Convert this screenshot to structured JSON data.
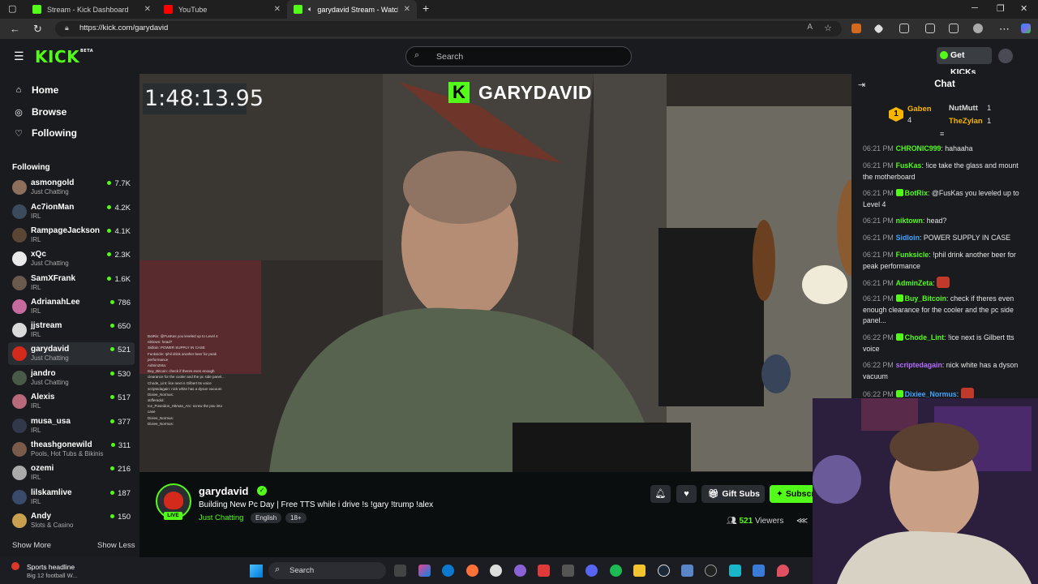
{
  "browser": {
    "tabs": [
      {
        "title": "Stream - Kick Dashboard",
        "color": "#53fc18"
      },
      {
        "title": "YouTube",
        "color": "#ff0000"
      },
      {
        "title": "garydavid Stream - Watch Li",
        "color": "#53fc18"
      }
    ],
    "new_tab_label": "+",
    "url": "https://kick.com/garydavid"
  },
  "header": {
    "logo": "KICK",
    "logo_badge": "BETA",
    "search_placeholder": "Search",
    "get_kicks_label": "Get KICKs"
  },
  "sidebar": {
    "nav": [
      {
        "label": "Home",
        "icon": "home-icon"
      },
      {
        "label": "Browse",
        "icon": "compass-icon"
      },
      {
        "label": "Following",
        "icon": "heart-icon"
      }
    ],
    "following_heading": "Following",
    "following": [
      {
        "name": "asmongold",
        "category": "Just Chatting",
        "viewers": "7.7K",
        "color": "#8e6f5b"
      },
      {
        "name": "Ac7ionMan",
        "category": "IRL",
        "viewers": "4.2K",
        "color": "#3b4a5c"
      },
      {
        "name": "RampageJackson",
        "category": "IRL",
        "viewers": "4.1K",
        "color": "#5b4636"
      },
      {
        "name": "xQc",
        "category": "Just Chatting",
        "viewers": "2.3K",
        "color": "#e9e9e9"
      },
      {
        "name": "SamXFrank",
        "category": "IRL",
        "viewers": "1.6K",
        "color": "#6a5a4e"
      },
      {
        "name": "AdrianahLee",
        "category": "IRL",
        "viewers": "786",
        "color": "#c76a9e"
      },
      {
        "name": "jjstream",
        "category": "IRL",
        "viewers": "650",
        "color": "#d9d9d9"
      },
      {
        "name": "garydavid",
        "category": "Just Chatting",
        "viewers": "521",
        "color": "#d42a1b"
      },
      {
        "name": "jandro",
        "category": "Just Chatting",
        "viewers": "530",
        "color": "#4a5a48"
      },
      {
        "name": "Alexis",
        "category": "IRL",
        "viewers": "517",
        "color": "#b86a7a"
      },
      {
        "name": "musa_usa",
        "category": "IRL",
        "viewers": "377",
        "color": "#30384a"
      },
      {
        "name": "theashgonewild",
        "category": "Pools, Hot Tubs & Bikinis",
        "viewers": "311",
        "color": "#7a5a48"
      },
      {
        "name": "ozemi",
        "category": "IRL",
        "viewers": "216",
        "color": "#aaaaaa"
      },
      {
        "name": "lilskamlive",
        "category": "IRL",
        "viewers": "187",
        "color": "#3a4a6a"
      },
      {
        "name": "Andy",
        "category": "Slots & Casino",
        "viewers": "150",
        "color": "#c8a050"
      }
    ],
    "show_more": "Show More",
    "show_less": "Show Less"
  },
  "video": {
    "timer": "1:48:13.95",
    "brand_letter": "K",
    "brand_name": "GARYDAVID",
    "overlay_chat": [
      "BotRix: @FusKas you leveled up to Level 4",
      "niktown: head?",
      "Sidloin: POWER SUPPLY IN CASE",
      "Funksicle: !phil drink another beer for peak",
      "performance",
      "AdminZeta:",
      "Buy_Bitcoin: check if theres even enough",
      "clearance for the cooler and the pc side panel...",
      "Chode_Lint: lice next is Gilbert tts voice",
      "scriptedagain: nick white has a dyson vacuum",
      "Dixiee_Normus:",
      "stifferadol:",
      "Ice_Poseidon_Hitman_Arc: screw the psu into",
      "case",
      "Dixiee_Normus:",
      "Dixiee_Normus:"
    ]
  },
  "stream": {
    "channel": "garydavid",
    "live_label": "LIVE",
    "title": "Building New Pc Day | Free TTS while i drive !s !gary !trump !alex",
    "category": "Just Chatting",
    "tags": [
      "English",
      "18+"
    ],
    "gift_subs_label": "Gift Subs",
    "subscribe_label": "Subscribe",
    "viewer_count": "521",
    "viewers_label": "Viewers"
  },
  "chat": {
    "title": "Chat",
    "top_gifters": [
      {
        "name": "Gaben",
        "count": "4"
      },
      {
        "name": "NutMutt",
        "count": "1"
      },
      {
        "name": "TheZylan",
        "count": "1"
      }
    ],
    "messages": [
      {
        "time": "06:21 PM",
        "user": "CHRONIC999",
        "color": "#53fc18",
        "text": "hahaaha",
        "badge": false
      },
      {
        "time": "06:21 PM",
        "user": "FusKas",
        "color": "#53fc18",
        "text": "!ice take the glass and mount the motherboard",
        "badge": false
      },
      {
        "time": "06:21 PM",
        "user": "BotRix",
        "color": "#53fc18",
        "text": "@FusKas you leveled up to Level 4",
        "badge": true
      },
      {
        "time": "06:21 PM",
        "user": "niktown",
        "color": "#53fc18",
        "text": "head?",
        "badge": false
      },
      {
        "time": "06:21 PM",
        "user": "Sidloin",
        "color": "#3ea6ff",
        "text": "POWER SUPPLY IN CASE",
        "badge": false
      },
      {
        "time": "06:21 PM",
        "user": "Funksicle",
        "color": "#53fc18",
        "text": "!phil drink another beer for peak performance",
        "badge": false
      },
      {
        "time": "06:21 PM",
        "user": "AdminZeta",
        "color": "#53fc18",
        "text": "",
        "badge": false,
        "emote": true
      },
      {
        "time": "06:21 PM",
        "user": "Buy_Bitcoin",
        "color": "#53fc18",
        "text": "check if theres even enough clearance for the cooler and the pc side panel...",
        "badge": true
      },
      {
        "time": "06:22 PM",
        "user": "Chode_Lint",
        "color": "#53fc18",
        "text": "!ice next is Gilbert tts voice",
        "badge": true
      },
      {
        "time": "06:22 PM",
        "user": "scriptedagain",
        "color": "#b66dff",
        "text": "nick white has a dyson vacuum",
        "badge": false
      },
      {
        "time": "06:22 PM",
        "user": "Dixiee_Normus",
        "color": "#3ea6ff",
        "text": "",
        "badge": true,
        "emote": true
      }
    ]
  },
  "taskbar": {
    "news_title": "Sports headline",
    "news_sub": "Big 12 football W...",
    "search_label": "Search"
  },
  "colors": {
    "brand_green": "#53fc18",
    "background": "#0b0e0f",
    "panel": "#191b1f"
  }
}
